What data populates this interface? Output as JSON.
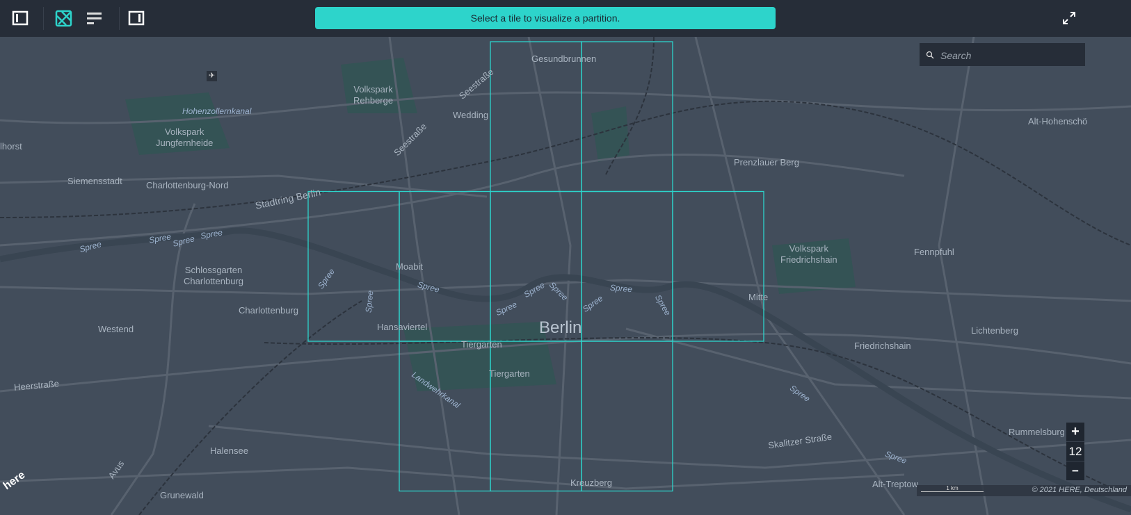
{
  "toolbar": {
    "banner": "Select a tile to visualize a partition.",
    "accent": "#2dd4cb"
  },
  "search": {
    "placeholder": "Search"
  },
  "zoom": {
    "plus": "+",
    "level": "12",
    "minus": "−"
  },
  "attribution": {
    "scale": "1 km",
    "copyright": "© 2021 HERE, Deutschland",
    "logo": "here"
  },
  "labels": {
    "gesundbrunnen": "Gesundbrunnen",
    "volkspark_rehberge": "Volkspark\nRehberge",
    "wedding": "Wedding",
    "hohenzollernkanal": "Hohenzollernkanal",
    "volkspark_jungfernheide": "Volkspark\nJungfernheide",
    "hohenschoen": "Alt-Hohenschö",
    "lhorst": "lhorst",
    "siemensstadt": "Siemensstadt",
    "charlottenburg_nord": "Charlottenburg-Nord",
    "stadtring": "Stadtring Berlin",
    "prenzlauer": "Prenzlauer Berg",
    "seestrasse1": "Seestraße",
    "seestrasse2": "Seestraße",
    "schlossgarten": "Schlossgarten\nCharlottenburg",
    "moabit": "Moabit",
    "volkspark_fhain": "Volkspark\nFriedrichshain",
    "fennpfuhl": "Fennpfuhl",
    "charlottenburg": "Charlottenburg",
    "mitte": "Mitte",
    "westend": "Westend",
    "hansaviertel": "Hansaviertel",
    "berlin": "Berlin",
    "tiergarten1": "Tiergarten",
    "tiergarten2": "Tiergarten",
    "friedrichshain": "Friedrichshain",
    "lichtenberg": "Lichtenberg",
    "heerstrasse": "Heerstraße",
    "landwehrkanal": "Landwehrkanal",
    "halensee": "Halensee",
    "avus": "Avus",
    "skalitzer": "Skalitzer Straße",
    "rummelsburg": "Rummelsburg",
    "kreuzberg": "Kreuzberg",
    "alt_treptow": "Alt-Treptow",
    "grunewald": "Grunewald",
    "spree": "Spree"
  }
}
